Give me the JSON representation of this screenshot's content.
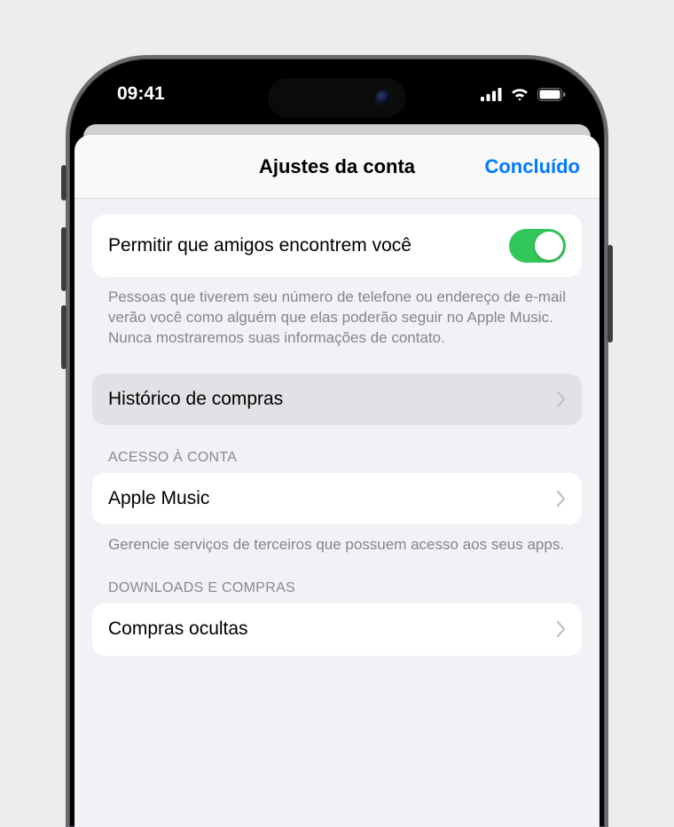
{
  "status": {
    "time": "09:41"
  },
  "nav": {
    "title": "Ajustes da conta",
    "done": "Concluído"
  },
  "friends": {
    "label": "Permitir que amigos encontrem você",
    "description": "Pessoas que tiverem seu número de telefone ou endereço de e-mail verão você como alguém que elas poderão seguir no Apple Music. Nunca mostraremos suas informações de contato."
  },
  "purchaseHistory": {
    "label": "Histórico de compras"
  },
  "accountAccess": {
    "header": "ACESSO À CONTA",
    "item": "Apple Music",
    "footer": "Gerencie serviços de terceiros que possuem acesso aos seus apps."
  },
  "downloads": {
    "header": "DOWNLOADS E COMPRAS",
    "item": "Compras ocultas"
  }
}
